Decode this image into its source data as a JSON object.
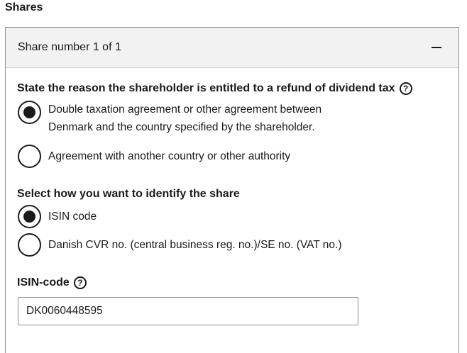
{
  "section": {
    "title": "Shares"
  },
  "panel": {
    "title": "Share number 1 of 1",
    "collapse_symbol": "−"
  },
  "reason": {
    "label": "State the reason the shareholder is entitled to a refund of dividend tax",
    "help": "?",
    "options": [
      {
        "line1": "Double taxation agreement or other agreement between",
        "line2": "Denmark and the country specified by the shareholder.",
        "selected": true
      },
      {
        "line1": "Agreement with another country or other authority",
        "selected": false
      }
    ]
  },
  "identify": {
    "label": "Select how you want to identify the share",
    "options": [
      {
        "label": "ISIN code",
        "selected": true
      },
      {
        "label": "Danish CVR no. (central business reg. no.)/SE no. (VAT no.)",
        "selected": false
      }
    ]
  },
  "isin": {
    "label": "ISIN-code",
    "help": "?",
    "value": "DK0060448595"
  }
}
